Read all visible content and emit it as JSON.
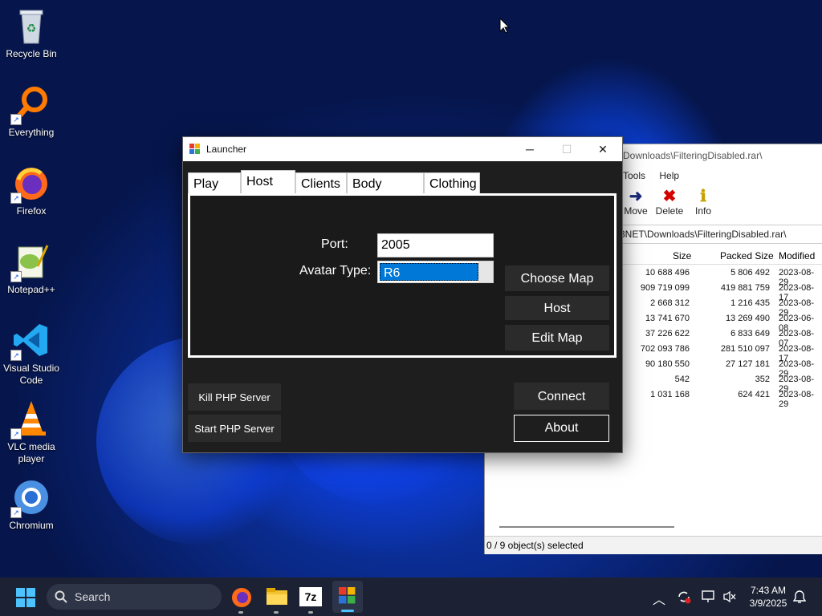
{
  "desktop": {
    "icons": [
      {
        "label": "Recycle Bin"
      },
      {
        "label": "Everything"
      },
      {
        "label": "Firefox"
      },
      {
        "label": "Notepad++"
      },
      {
        "label": "Visual Studio Code"
      },
      {
        "label": "VLC media player"
      },
      {
        "label": "Chromium"
      }
    ]
  },
  "zip_window": {
    "title": "Downloads\\FilteringDisabled.rar\\",
    "menu": [
      "Tools",
      "Help"
    ],
    "toolbar": [
      {
        "label": "Move",
        "icon": "move-arrow-icon"
      },
      {
        "label": "Delete",
        "icon": "delete-x-icon"
      },
      {
        "label": "Info",
        "icon": "info-icon"
      }
    ],
    "path": "3NET\\Downloads\\FilteringDisabled.rar\\",
    "columns": [
      "Size",
      "Packed Size",
      "Modified"
    ],
    "rows": [
      {
        "size": "10 688 496",
        "packed": "5 806 492",
        "modified": "2023-08-29"
      },
      {
        "size": "909 719 099",
        "packed": "419 881 759",
        "modified": "2023-08-17"
      },
      {
        "size": "2 668 312",
        "packed": "1 216 435",
        "modified": "2023-08-29"
      },
      {
        "size": "13 741 670",
        "packed": "13 269 490",
        "modified": "2023-06-08"
      },
      {
        "size": "37 226 622",
        "packed": "6 833 649",
        "modified": "2023-08-07"
      },
      {
        "size": "702 093 786",
        "packed": "281 510 097",
        "modified": "2023-08-17"
      },
      {
        "size": "90 180 550",
        "packed": "27 127 181",
        "modified": "2023-08-29"
      },
      {
        "size": "542",
        "packed": "352",
        "modified": "2023-08-29"
      },
      {
        "size": "1 031 168",
        "packed": "624 421",
        "modified": "2023-08-29"
      }
    ],
    "status": "0 / 9 object(s) selected"
  },
  "launcher": {
    "title": "Launcher",
    "controls": {
      "minimize": "─",
      "maximize": "☐",
      "close": "✕"
    },
    "tabs": [
      "Play",
      "Host",
      "Clients",
      "Body Colors",
      "Clothing"
    ],
    "active_tab": "Host",
    "host": {
      "port_label": "Port:",
      "port_value": "2005",
      "avatar_label": "Avatar Type:",
      "avatar_value": "R6",
      "choose_map": "Choose Map",
      "host_button": "Host",
      "edit_map": "Edit Map"
    },
    "bottom": {
      "kill_php": "Kill PHP Server",
      "start_php": "Start PHP Server",
      "connect": "Connect",
      "about": "About"
    }
  },
  "taskbar": {
    "search_placeholder": "Search",
    "time": "7:43 AM",
    "date": "3/9/2025",
    "zip_app_label": "7z"
  }
}
